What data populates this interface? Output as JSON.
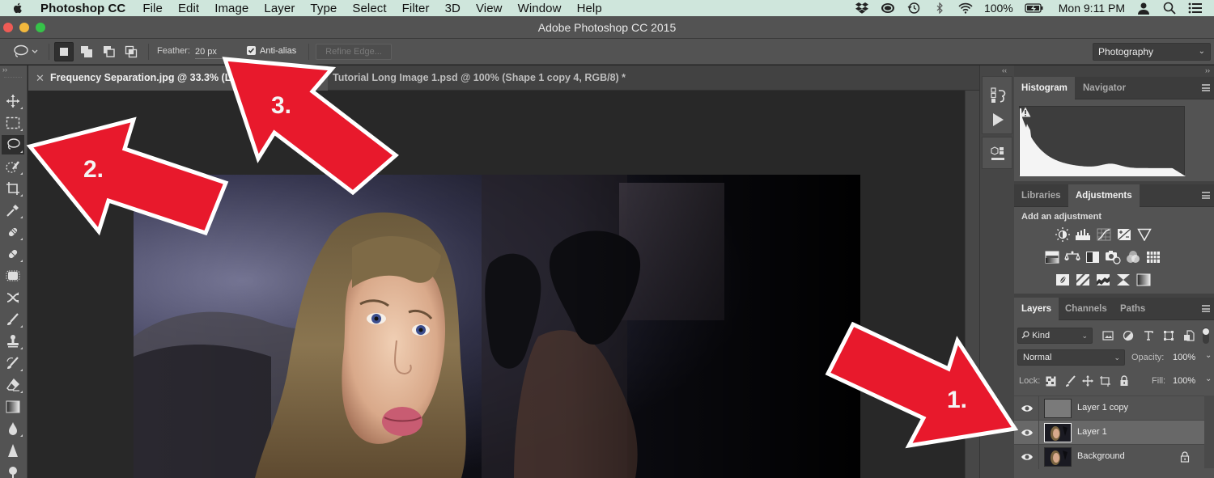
{
  "menubar": {
    "app_name": "Photoshop CC",
    "items": [
      "File",
      "Edit",
      "Image",
      "Layer",
      "Type",
      "Select",
      "Filter",
      "3D",
      "View",
      "Window",
      "Help"
    ],
    "status": {
      "battery": "100%",
      "clock": "Mon 9:11 PM"
    }
  },
  "window": {
    "title": "Adobe Photoshop CC 2015"
  },
  "options_bar": {
    "tool_icon": "lasso-icon",
    "feather_label": "Feather:",
    "feather_value": "20 px",
    "anti_alias_label": "Anti-alias",
    "anti_alias_checked": true,
    "refine_edge_label": "Refine Edge...",
    "workspace": "Photography"
  },
  "toolbar": {
    "collapse_label": "››",
    "active_tool": "lasso",
    "tools": [
      "move",
      "marquee",
      "lasso",
      "quick-selection",
      "crop",
      "eyedropper",
      "spot-healing-brush",
      "brush-healing",
      "clone-patch",
      "content-aware-move",
      "brush",
      "clone-stamp",
      "history-brush",
      "eraser",
      "gradient",
      "blur",
      "sharpen",
      "dodge"
    ]
  },
  "documents": {
    "tabs": [
      {
        "label": "Frequency Separation.jpg @ 33.3% (Layer 1, RGB/8)",
        "active": true
      },
      {
        "label": "Tutorial Long Image 1.psd @ 100% (Shape 1 copy 4, RGB/8) *",
        "active": false
      }
    ]
  },
  "dock": {
    "collapse_label": "‹‹",
    "buttons": [
      "history-icon",
      "actions-play-icon",
      "properties-3d-icon"
    ]
  },
  "panels": {
    "collapse_label": "››",
    "histogram_group": {
      "tabs": [
        "Histogram",
        "Navigator"
      ],
      "active": "Histogram"
    },
    "adjustments_group": {
      "tabs": [
        "Libraries",
        "Adjustments"
      ],
      "active": "Adjustments",
      "title": "Add an adjustment",
      "rows": [
        [
          "brightness-contrast",
          "levels",
          "curves",
          "exposure",
          "vibrance"
        ],
        [
          "hue-saturation",
          "color-balance",
          "black-white",
          "photo-filter",
          "channel-mixer",
          "color-lookup"
        ],
        [
          "invert",
          "posterize",
          "threshold",
          "selective-color",
          "gradient-map"
        ]
      ]
    },
    "layers_group": {
      "tabs": [
        "Layers",
        "Channels",
        "Paths"
      ],
      "active": "Layers",
      "filter_kind": "Kind",
      "blend_mode": "Normal",
      "opacity_label": "Opacity:",
      "opacity_value": "100%",
      "lock_label": "Lock:",
      "fill_label": "Fill:",
      "fill_value": "100%",
      "layers": [
        {
          "name": "Layer 1 copy",
          "visible": true,
          "selected": false,
          "locked": false,
          "thumb": "gray"
        },
        {
          "name": "Layer 1",
          "visible": true,
          "selected": true,
          "locked": false,
          "thumb": "photo"
        },
        {
          "name": "Background",
          "visible": true,
          "selected": false,
          "locked": true,
          "thumb": "photo"
        }
      ]
    }
  },
  "annotations": [
    {
      "number": "1.",
      "points_to": "Layer 1"
    },
    {
      "number": "2.",
      "points_to": "Lasso tool"
    },
    {
      "number": "3.",
      "points_to": "Feather field"
    }
  ],
  "colors": {
    "arrow_fill": "#e8192c",
    "arrow_stroke": "#ffffff",
    "menubar_bg": "#cfe6dc",
    "panel_bg": "#535353",
    "canvas_bg": "#282828"
  }
}
